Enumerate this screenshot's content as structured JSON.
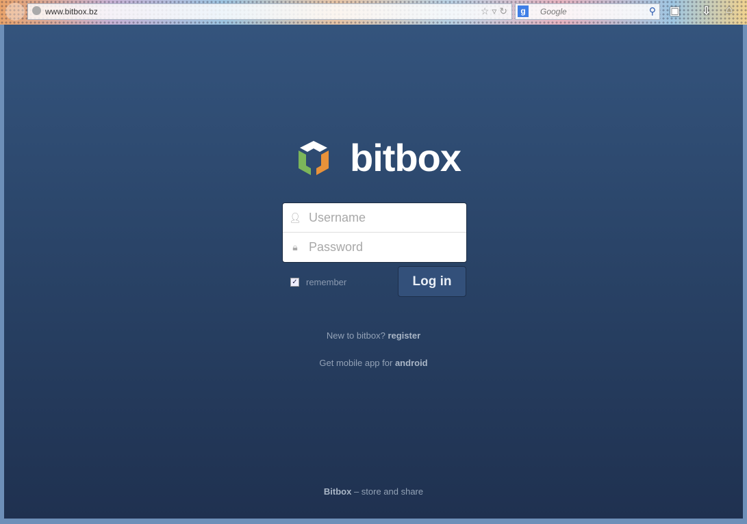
{
  "browser": {
    "url": "www.bitbox.bz",
    "search_placeholder": "Google"
  },
  "brand": {
    "name": "bitbox",
    "colors": {
      "green": "#7cb65a",
      "orange": "#e8923a",
      "white": "#ffffff"
    }
  },
  "login": {
    "username_placeholder": "Username",
    "password_placeholder": "Password",
    "remember_label": "remember",
    "remember_checked": true,
    "submit_label": "Log in"
  },
  "links": {
    "register_prefix": "New to bitbox?",
    "register": "register",
    "mobile_prefix": "Get mobile app for",
    "android": "android"
  },
  "footer": {
    "brand": "Bitbox",
    "tagline": "– store and share"
  }
}
